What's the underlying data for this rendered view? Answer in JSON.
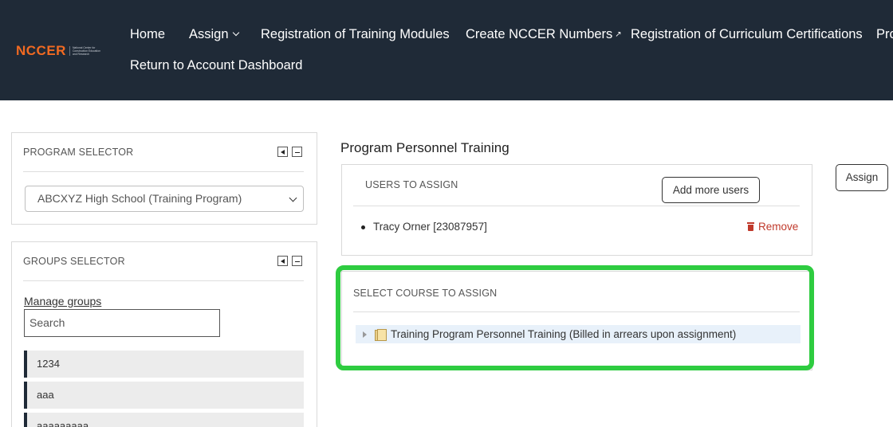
{
  "header": {
    "logo_text": "NCCER",
    "logo_tagline": "National Center for Construction Education and Research",
    "nav": [
      {
        "label": "Home"
      },
      {
        "label": "Assign"
      },
      {
        "label": "Registration of Training Modules"
      },
      {
        "label": "Create NCCER Numbers"
      },
      {
        "label": "Registration of Curriculum Certifications"
      },
      {
        "label": "Pro"
      },
      {
        "label": "Return to Account Dashboard"
      }
    ]
  },
  "program_selector": {
    "title": "PROGRAM SELECTOR",
    "selected": "ABCXYZ High School (Training Program)"
  },
  "groups_selector": {
    "title": "GROUPS SELECTOR",
    "manage_link": "Manage groups",
    "search_placeholder": "Search",
    "groups": [
      "1234",
      "aaa",
      "aaaaaaaaa"
    ]
  },
  "main": {
    "title": "Program Personnel Training",
    "assign_button": "Assign",
    "users_section": {
      "title": "USERS TO ASSIGN",
      "add_more_button": "Add more users",
      "users": [
        {
          "name": "Tracy Orner [23087957]",
          "remove_label": "Remove"
        }
      ]
    },
    "course_section": {
      "title": "SELECT COURSE TO ASSIGN",
      "course": "Training Program Personnel Training (Billed in arrears upon assignment)"
    }
  },
  "colors": {
    "header_bg": "#1f2a37",
    "logo_orange": "#f26a21",
    "highlight_green": "#2ecc40",
    "remove_red": "#c0392b"
  }
}
